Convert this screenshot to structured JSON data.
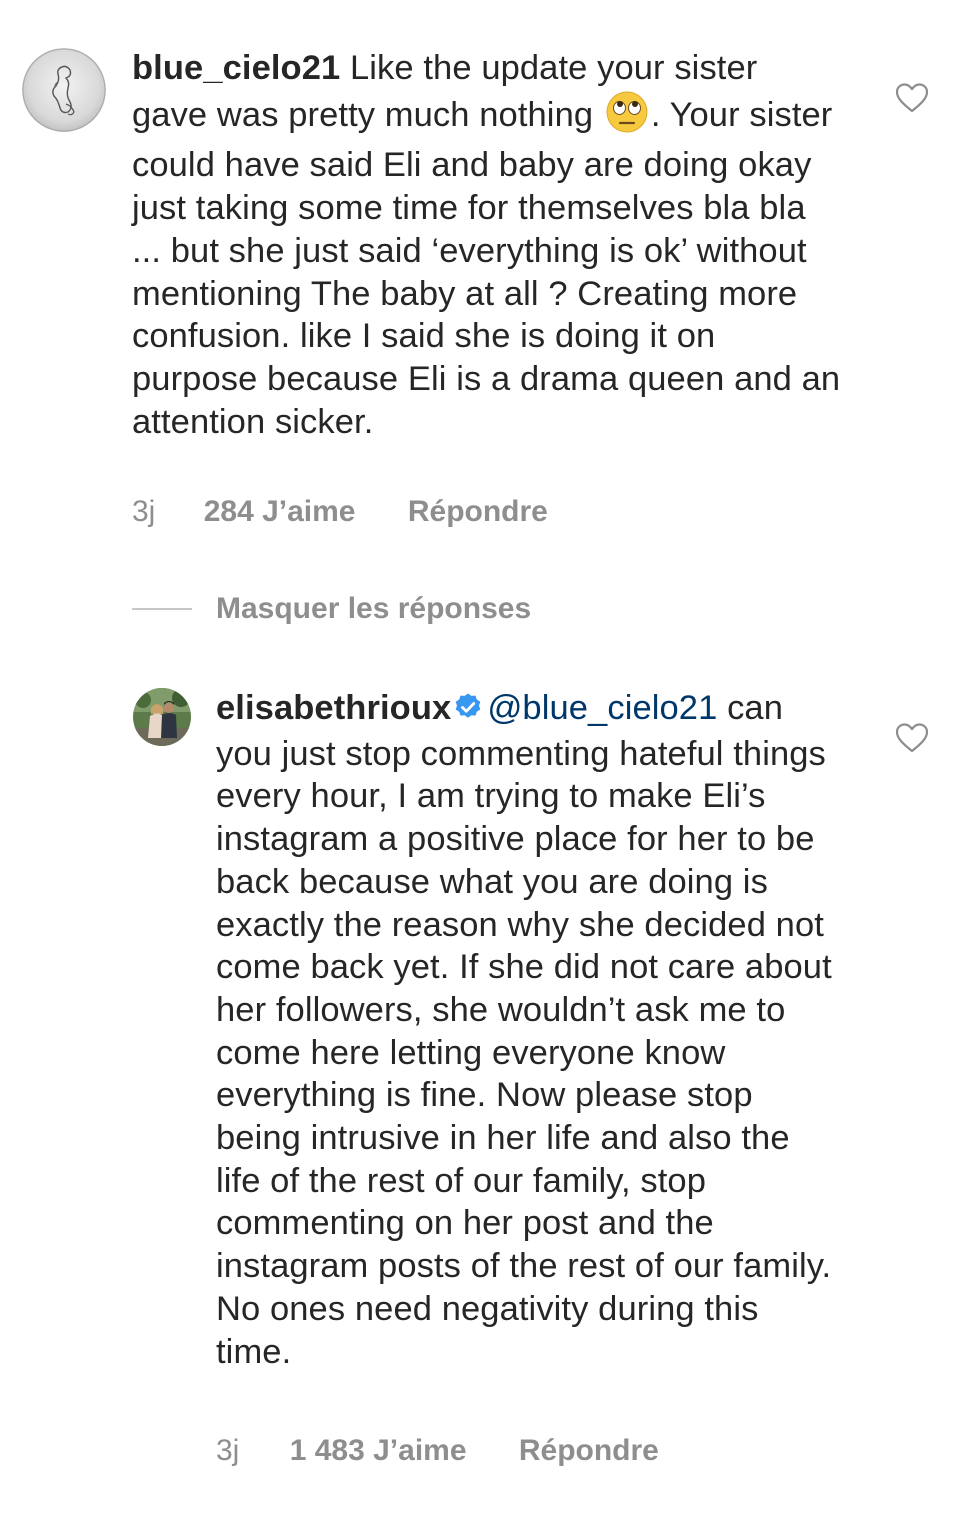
{
  "comments": [
    {
      "username": "blue_cielo21",
      "text_before_emoji": "Like the update your sister gave was pretty much nothing",
      "emoji": "face-with-rolling-eyes",
      "text_after_emoji": ". Your sister could have said Eli and baby are doing okay just taking some time for themselves bla bla ... but she just said ‘everything is ok’ without mentioning The baby at all ? Creating more confusion. like I said she is doing it on purpose because Eli is a drama queen and an attention sicker.",
      "time": "3j",
      "likes": "284 J’aime",
      "reply_label": "Répondre"
    },
    {
      "username": "elisabethrioux",
      "verified": true,
      "mention": "@blue_cielo21",
      "text": "can you just stop commenting hateful things every hour, I am trying to make Eli’s instagram a positive place for her to be back because what you are doing is exactly the reason why she decided not come back yet. If she did not care about her followers, she wouldn’t ask me to come here letting everyone know everything is fine. Now please stop being intrusive in her life and also the life of the rest of our family, stop commenting on her post and the instagram posts of the rest of our family. No ones need negativity during this time.",
      "time": "3j",
      "likes": "1 483 J’aime",
      "reply_label": "Répondre"
    }
  ],
  "hide_replies_label": "Masquer les réponses",
  "colors": {
    "text": "#262626",
    "secondary": "#8e8e8e",
    "mention": "#00376b",
    "verified": "#3897f0",
    "divider": "#c7c7c7"
  },
  "icons": {
    "like": "heart-outline-icon",
    "verified": "verified-badge-icon"
  }
}
